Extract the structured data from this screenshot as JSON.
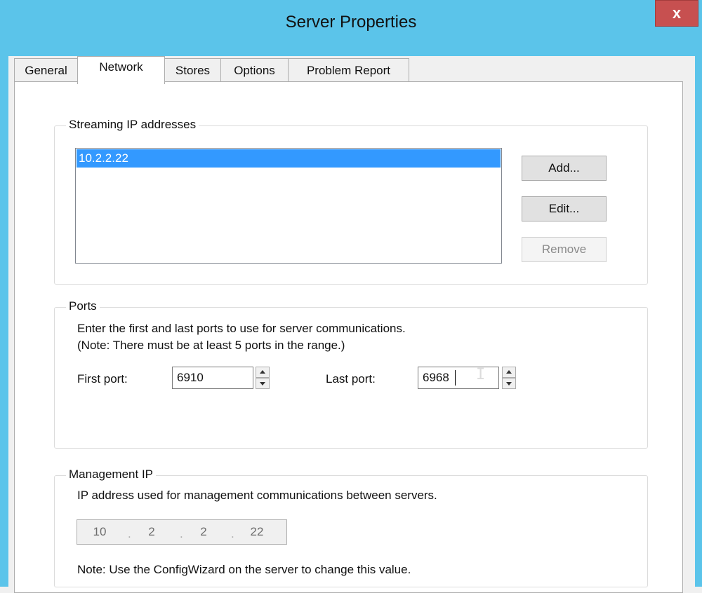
{
  "window": {
    "title": "Server Properties",
    "close_label": "x"
  },
  "tabs": [
    {
      "label": "General",
      "selected": false
    },
    {
      "label": "Network",
      "selected": true
    },
    {
      "label": "Stores",
      "selected": false
    },
    {
      "label": "Options",
      "selected": false
    },
    {
      "label": "Problem Report",
      "selected": false
    }
  ],
  "streaming": {
    "group_title": "Streaming IP addresses",
    "items": [
      "10.2.2.22"
    ],
    "add_label": "Add...",
    "edit_label": "Edit...",
    "remove_label": "Remove"
  },
  "ports": {
    "group_title": "Ports",
    "description_line1": "Enter the first and last ports to use for server communications.",
    "description_line2": "(Note: There must be at least 5 ports in the range.)",
    "first_port_label": "First port:",
    "first_port_value": "6910",
    "last_port_label": "Last port:",
    "last_port_value": "6968"
  },
  "management": {
    "group_title": "Management IP",
    "description": "IP address used for management communications between servers.",
    "ip_segments": [
      "10",
      "2",
      "2",
      "22"
    ],
    "note": "Note: Use the ConfigWizard on the server to change this value."
  }
}
